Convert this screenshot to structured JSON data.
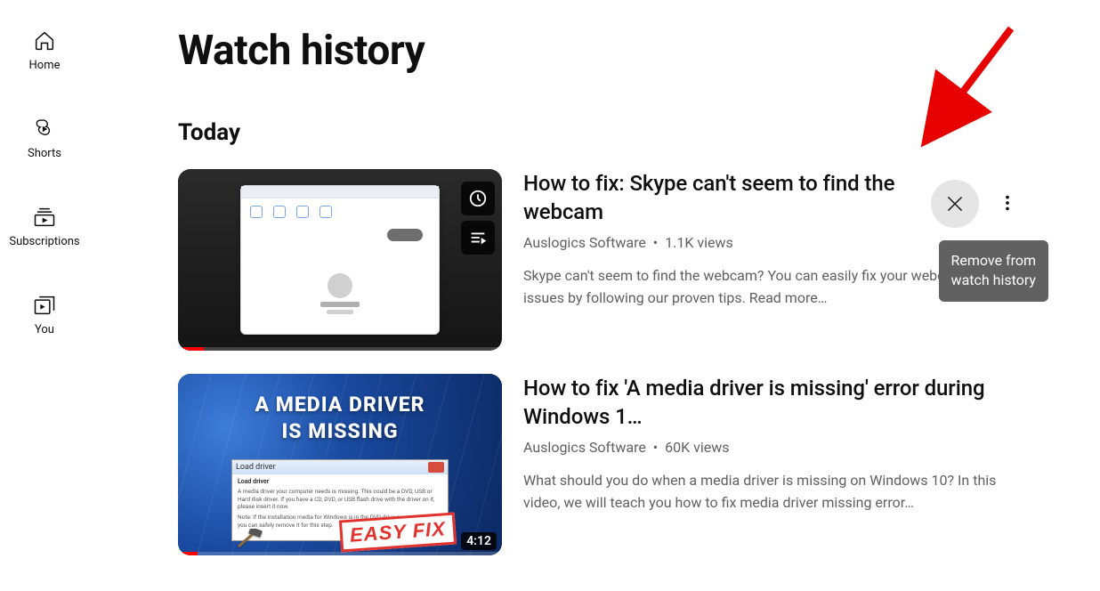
{
  "sidebar": {
    "items": [
      {
        "label": "Home"
      },
      {
        "label": "Shorts"
      },
      {
        "label": "Subscriptions"
      },
      {
        "label": "You"
      }
    ]
  },
  "page": {
    "title": "Watch history",
    "section": "Today"
  },
  "videos": [
    {
      "title": "How to fix: Skype can't seem to find the webcam",
      "channel": "Auslogics Software",
      "views": "1.1K views",
      "description": "Skype can't seem to find the webcam? You can easily fix your webcam-related issues by following our proven tips. Read more…",
      "progress_pct": 8,
      "tooltip": "Remove from watch history"
    },
    {
      "title": "How to fix 'A media driver is missing' error during Windows 1…",
      "channel": "Auslogics Software",
      "views": "60K views",
      "description": "What should you do when a media driver is missing on Windows 10? In this video, we will teach you how to fix media driver missing error…",
      "duration": "4:12",
      "progress_pct": 6,
      "thumb_headline": "A MEDIA DRIVER\nIS MISSING",
      "thumb_badge": "EASY FIX",
      "thumb_dialog_title": "Load driver",
      "thumb_dialog_l1": "A media driver your computer needs is missing. This could be a DVD, USB or Hard disk driver. If you have a CD, DVD, or USB flash drive with the driver on it, please insert it now.",
      "thumb_dialog_l2": "Note: If the installation media for Windows is in the DVD drive or on a USB drive, you can safely remove it for this step."
    }
  ]
}
